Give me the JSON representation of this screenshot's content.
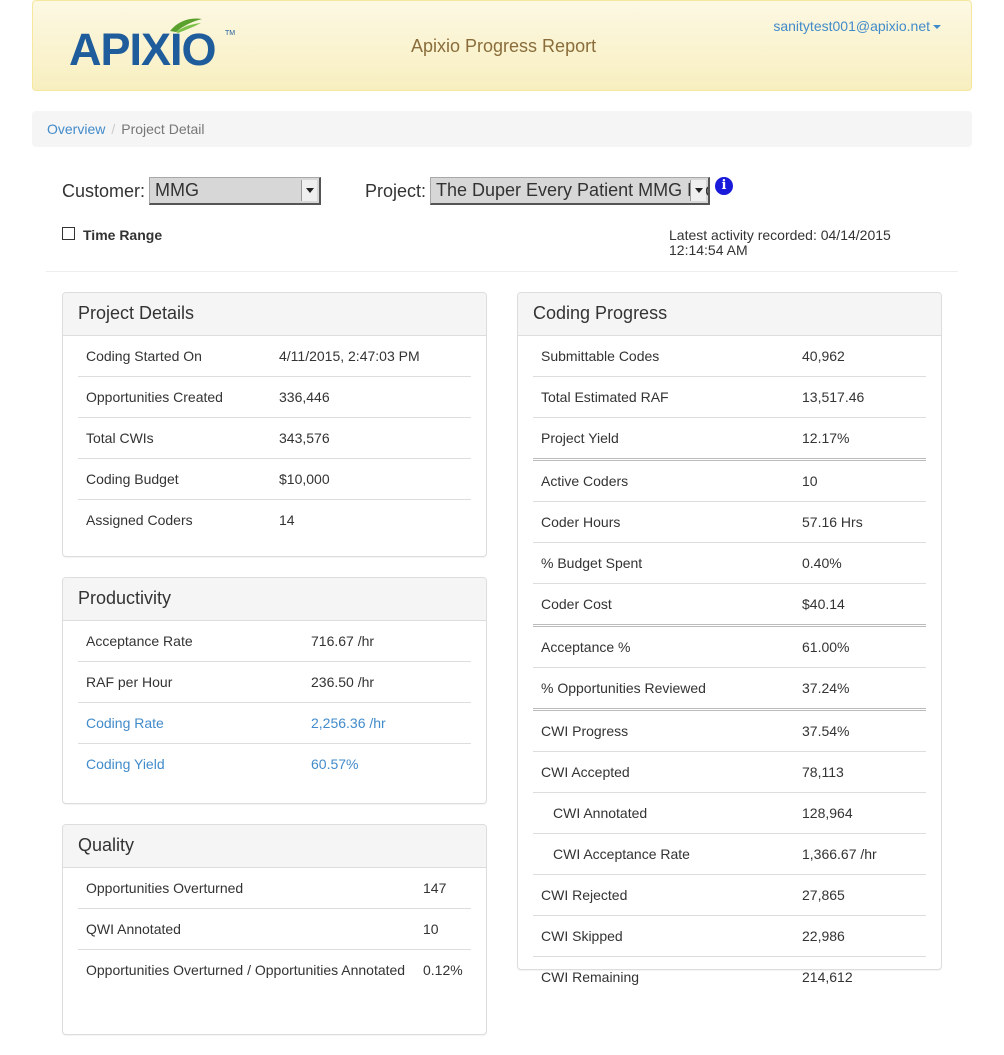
{
  "header": {
    "logo_text": "APIXIO",
    "logo_tm": "TM",
    "title": "Apixio Progress Report",
    "user_email": "sanitytest001@apixio.net"
  },
  "breadcrumb": {
    "items": [
      "Overview",
      "Project Detail"
    ],
    "separator": "/"
  },
  "filters": {
    "customer_label": "Customer:",
    "customer_value": "MMG",
    "project_label": "Project:",
    "project_value": "The Duper Every Patient MMG Project",
    "info_glyph": "i",
    "time_range_label": "Time Range",
    "time_range_checked": false,
    "latest_activity": "Latest activity recorded: 04/14/2015 12:14:54 AM"
  },
  "project_details": {
    "title": "Project Details",
    "rows": [
      {
        "label": "Coding Started On",
        "value": "4/11/2015, 2:47:03 PM"
      },
      {
        "label": "Opportunities Created",
        "value": "336,446"
      },
      {
        "label": "Total CWIs",
        "value": "343,576"
      },
      {
        "label": "Coding Budget",
        "value": "$10,000"
      },
      {
        "label": "Assigned Coders",
        "value": "14"
      }
    ]
  },
  "productivity": {
    "title": "Productivity",
    "rows": [
      {
        "label": "Acceptance Rate",
        "value": "716.67 /hr"
      },
      {
        "label": "RAF per Hour",
        "value": "236.50 /hr"
      },
      {
        "label": "Coding Rate",
        "value": "2,256.36 /hr"
      },
      {
        "label": "Coding Yield",
        "value": "60.57%"
      }
    ]
  },
  "quality": {
    "title": "Quality",
    "rows": [
      {
        "label": "Opportunities Overturned",
        "value": "147"
      },
      {
        "label": "QWI Annotated",
        "value": "10"
      },
      {
        "label": "Opportunities Overturned / Opportunities Annotated",
        "value": "0.12%"
      }
    ]
  },
  "coding_progress": {
    "title": "Coding Progress",
    "rows": [
      {
        "label": "Submittable Codes",
        "value": "40,962"
      },
      {
        "label": "Total Estimated RAF",
        "value": "13,517.46"
      },
      {
        "label": "Project Yield",
        "value": "12.17%"
      },
      {
        "label": "Active Coders",
        "value": "10"
      },
      {
        "label": "Coder Hours",
        "value": "57.16 Hrs"
      },
      {
        "label": "% Budget Spent",
        "value": "0.40%"
      },
      {
        "label": "Coder Cost",
        "value": "$40.14"
      },
      {
        "label": "Acceptance %",
        "value": "61.00%"
      },
      {
        "label": "% Opportunities Reviewed",
        "value": "37.24%"
      },
      {
        "label": "CWI Progress",
        "value": "37.54%"
      },
      {
        "label": "CWI Accepted",
        "value": "78,113"
      },
      {
        "label": "CWI Annotated",
        "value": "128,964"
      },
      {
        "label": "CWI Acceptance Rate",
        "value": "1,366.67 /hr"
      },
      {
        "label": "CWI Rejected",
        "value": "27,865"
      },
      {
        "label": "CWI Skipped",
        "value": "22,986"
      },
      {
        "label": "CWI Remaining",
        "value": "214,612"
      }
    ]
  },
  "colors": {
    "header_bg": "#fcf8e3",
    "header_text": "#8a6d3b",
    "link": "#428bca",
    "logo_blue": "#1f5c9c",
    "logo_green": "#5aa02c",
    "info_icon": "#1a1adb"
  }
}
